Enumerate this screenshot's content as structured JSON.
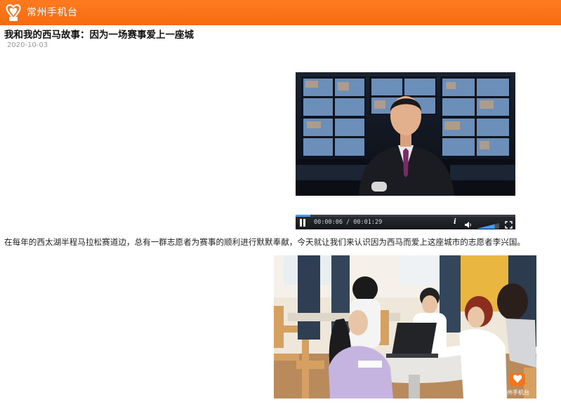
{
  "header": {
    "app_name": "常州手机台",
    "brand_color": "#f7731a",
    "logo_icon": "flower-logo-icon"
  },
  "article": {
    "title": "我和我的西马故事：因为一场赛事爱上一座城",
    "date": "2020-10-03",
    "paragraph": "在每年的西太湖半程马拉松赛道边，总有一群志愿者为赛事的顺利进行默默奉献，今天就让我们来认识因为西马而爱上这座城市的志愿者李兴国。"
  },
  "video_player": {
    "time_display": "00:00:06 / 00:01:29",
    "progress_fraction": 0.067,
    "volume_fraction": 0.8,
    "info_label": "i",
    "state": "playing",
    "icons": [
      "pause-icon",
      "info-icon",
      "volume-icon",
      "fullscreen-icon"
    ]
  },
  "photo": {
    "watermark": "常州手机台"
  }
}
